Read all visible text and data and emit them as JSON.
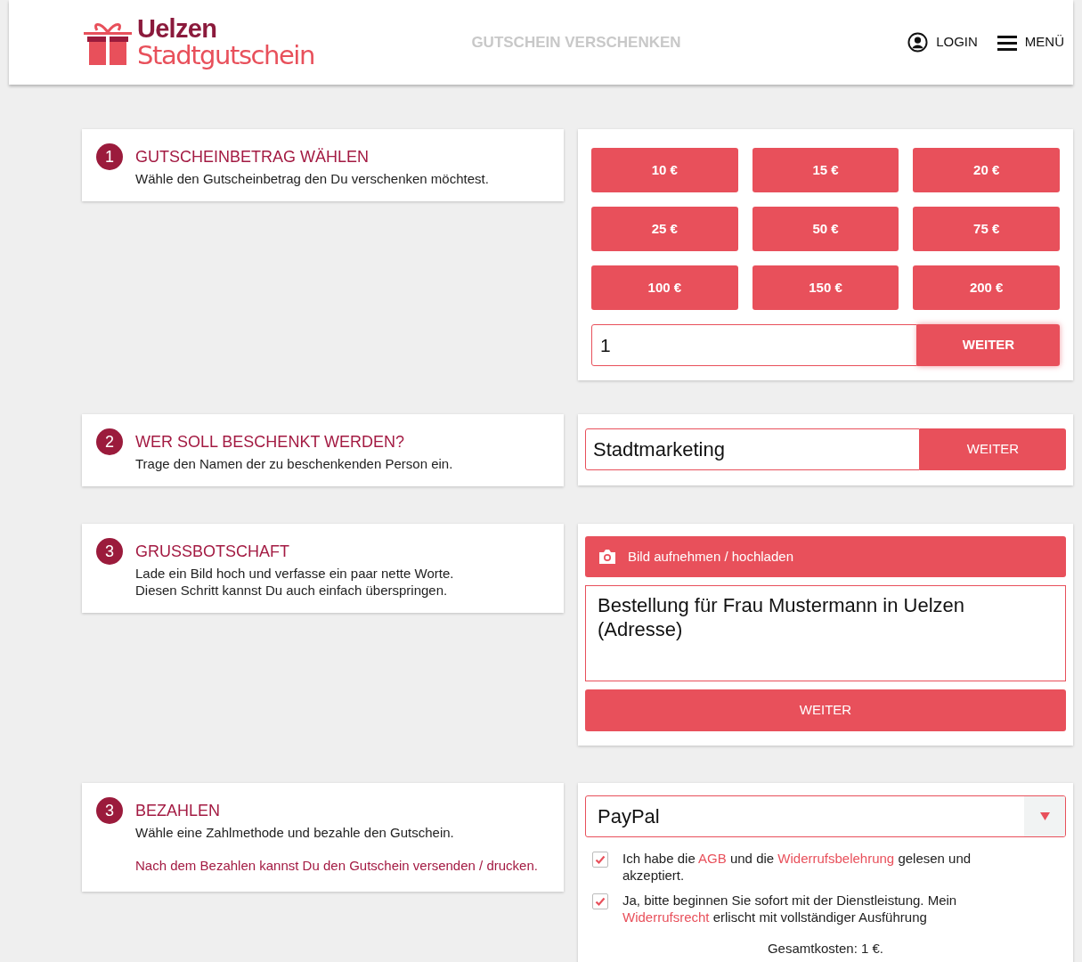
{
  "header": {
    "logo": {
      "line1": "Uelzen",
      "line2": "Stadtgutschein"
    },
    "nav_title": "GUTSCHEIN VERSCHENKEN",
    "login": "LOGIN",
    "menu": "MENÜ"
  },
  "steps": [
    {
      "number": "1",
      "title": "GUTSCHEINBETRAG WÄHLEN",
      "description": [
        "Wähle den Gutscheinbetrag den Du verschenken möchtest."
      ]
    },
    {
      "number": "2",
      "title": "WER SOLL BESCHENKT WERDEN?",
      "description": [
        "Trage den Namen der zu beschenkenden Person ein."
      ]
    },
    {
      "number": "3",
      "title": "GRUSSBOTSCHAFT",
      "description": [
        "Lade ein Bild hoch und verfasse ein paar nette Worte.",
        "Diesen Schritt kannst Du auch einfach überspringen."
      ]
    },
    {
      "number": "3",
      "title": "BEZAHLEN",
      "description": [
        "Wähle eine Zahlmethode und bezahle den Gutschein."
      ],
      "note": "Nach dem Bezahlen kannst Du den Gutschein versenden / drucken."
    }
  ],
  "amount_panel": {
    "amounts": [
      "10 €",
      "15 €",
      "20 €",
      "25 €",
      "50 €",
      "75 €",
      "100 €",
      "150 €",
      "200 €"
    ],
    "quantity": "1",
    "button": "WEITER"
  },
  "recipient_panel": {
    "value": "Stadtmarketing",
    "button": "WEITER"
  },
  "message_panel": {
    "upload_button": "Bild aufnehmen / hochladen",
    "message": "Bestellung für Frau Mustermann in Uelzen (Adresse)",
    "button": "WEITER"
  },
  "payment_panel": {
    "method": "PayPal",
    "consents": [
      {
        "checked": true,
        "parts": [
          {
            "text": "Ich habe die ",
            "link": false
          },
          {
            "text": "AGB",
            "link": true
          },
          {
            "text": " und die ",
            "link": false
          },
          {
            "text": "Widerrufsbelehrung",
            "link": true
          },
          {
            "text": " gelesen und akzeptiert.",
            "link": false
          }
        ]
      },
      {
        "checked": true,
        "parts": [
          {
            "text": "Ja, bitte beginnen Sie sofort mit der Dienstleistung. Mein ",
            "link": false
          },
          {
            "text": "Widerrufsrecht",
            "link": true
          },
          {
            "text": " erlischt mit vollständiger Ausführung",
            "link": false
          }
        ]
      }
    ],
    "total": "Gesamtkosten: 1 €."
  }
}
